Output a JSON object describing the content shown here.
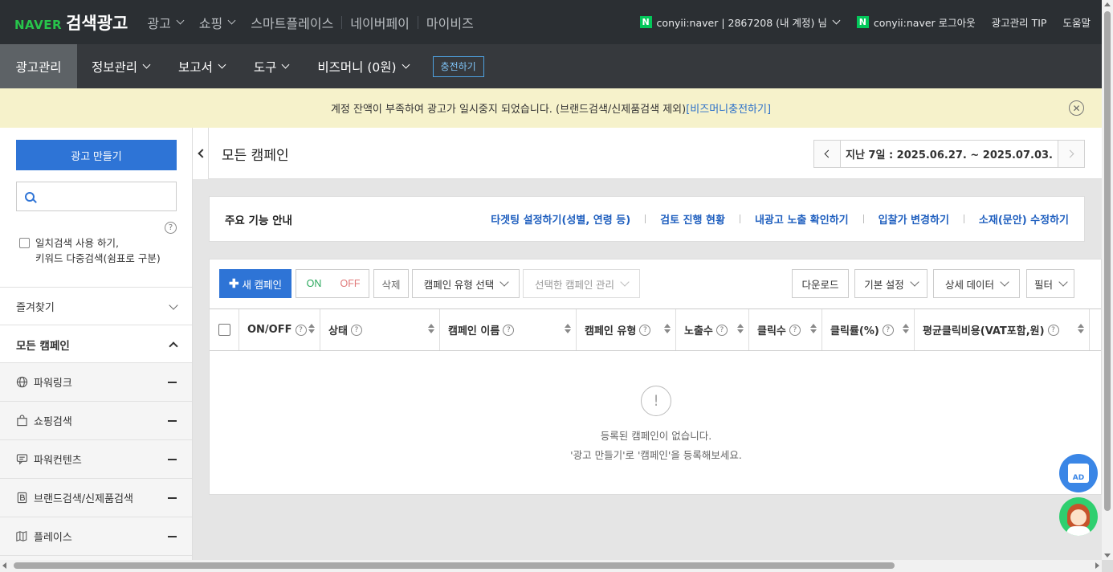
{
  "header": {
    "logo_naver": "NAVER",
    "logo_brand": "검색광고",
    "nav": [
      {
        "label": "광고",
        "dropdown": true
      },
      {
        "label": "쇼핑",
        "dropdown": true
      },
      {
        "label": "스마트플레이스",
        "dropdown": false
      },
      {
        "label": "네이버페이",
        "dropdown": false
      },
      {
        "label": "마이비즈",
        "dropdown": false
      }
    ],
    "account_badge": "N",
    "account_label": "conyii:naver | 2867208 (내 계정) 님",
    "logout_badge": "N",
    "logout_label": "conyii:naver 로그아웃",
    "tip_label": "광고관리 TIP",
    "help_label": "도움말"
  },
  "mainnav": {
    "tabs": [
      {
        "label": "광고관리",
        "active": true
      },
      {
        "label": "정보관리",
        "dropdown": true
      },
      {
        "label": "보고서",
        "dropdown": true
      },
      {
        "label": "도구",
        "dropdown": true
      },
      {
        "label": "비즈머니 (0원)",
        "dropdown": true
      }
    ],
    "charge_button": "충전하기"
  },
  "notice": {
    "text": "계정 잔액이 부족하여 광고가 일시중지 되었습니다. (브랜드검색/신제품검색 제외)",
    "link": "[비즈머니충전하기]",
    "close_symbol": "✕"
  },
  "sidebar": {
    "create_button": "광고 만들기",
    "search_placeholder": "",
    "help_symbol": "?",
    "exact_line1": "일치검색 사용 하기,",
    "exact_line2": "키워드 다중검색(쉼표로 구분)",
    "favorites": "즐겨찾기",
    "all_campaigns": "모든 캠페인",
    "campaign_types": [
      {
        "label": "파워링크",
        "icon": "globe-icon"
      },
      {
        "label": "쇼핑검색",
        "icon": "shopping-bag-icon"
      },
      {
        "label": "파워컨텐츠",
        "icon": "speech-bubble-icon"
      },
      {
        "label": "브랜드검색/신제품검색",
        "icon": "brand-b-icon"
      },
      {
        "label": "플레이스",
        "icon": "map-icon"
      }
    ]
  },
  "page": {
    "title": "모든 캠페인",
    "date_range": "지난 7일 : 2025.06.27. ~ 2025.07.03."
  },
  "guide": {
    "title": "주요 기능 안내",
    "links": [
      "타겟팅 설정하기(성별, 연령 등)",
      "검토 진행 현황",
      "내광고 노출 확인하기",
      "입찰가 변경하기",
      "소재(문안) 수정하기"
    ]
  },
  "toolbar": {
    "new_campaign": "새 캠페인",
    "on": "ON",
    "off": "OFF",
    "delete": "삭제",
    "type_select": "캠페인 유형 선택",
    "manage_selected": "선택한 캠페인 관리",
    "download": "다운로드",
    "basic_settings": "기본 설정",
    "detail_data": "상세 데이터",
    "filter": "필터"
  },
  "table": {
    "columns": [
      {
        "label": "ON/OFF",
        "help": true
      },
      {
        "label": "상태",
        "help": true
      },
      {
        "label": "캠페인 이름",
        "help": true
      },
      {
        "label": "캠페인 유형",
        "help": true
      },
      {
        "label": "노출수",
        "help": true
      },
      {
        "label": "클릭수",
        "help": true
      },
      {
        "label": "클릭률(%)",
        "help": true
      },
      {
        "label": "평균클릭비용(VAT포함,원)",
        "help": true
      }
    ],
    "empty_line1": "등록된 캠페인이 없습니다.",
    "empty_line2": "'광고 만들기'로 '캠페인'을 등록해보세요."
  },
  "floating": {
    "ad_label": "AD"
  },
  "colors": {
    "primary": "#2e74d6",
    "naver_green": "#03c75a",
    "topbar": "#2b2f33",
    "notice_bg": "#f6f2cb"
  }
}
